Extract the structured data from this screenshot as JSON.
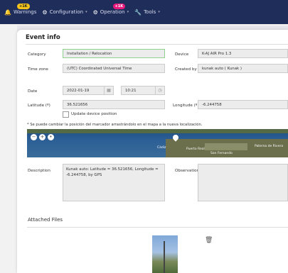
{
  "nav": {
    "warnings": {
      "label": "Warnings",
      "badge": "+1K"
    },
    "configuration": {
      "label": "Configuration"
    },
    "operation": {
      "label": "Operation",
      "badge": "+1K"
    },
    "tools": {
      "label": "Tools"
    }
  },
  "modal": {
    "title": "Event info",
    "category": {
      "label": "Category",
      "value": "Installation / Relocation"
    },
    "device": {
      "label": "Device",
      "value": "K-AJ AIR Pro 1.3"
    },
    "timezone": {
      "label": "Time zone",
      "value": "(UTC) Coordinated Universal Time"
    },
    "created_by": {
      "label": "Created by",
      "value": "kunak auto ( Kunak )"
    },
    "date": {
      "label": "Date",
      "date_value": "2022-01-19",
      "time_value": "10:21"
    },
    "latitude": {
      "label": "Latitude (º)",
      "value": "36.521656"
    },
    "longitude": {
      "label": "Longitude (º)",
      "value": "-6.244758"
    },
    "update_position": {
      "label": "Update device position"
    },
    "map_note": "* Se puede cambiar la posición del marcador arrastrándolo en el mapa a la nueva localización.",
    "map": {
      "labels": [
        "Cádiz",
        "Puerto Real",
        "San Fernando",
        "Paterna de Rivera"
      ]
    },
    "description": {
      "label": "Description",
      "value": "Kunak auto: Latitude = 36.521656, Longitude = -6.244758, by GPS"
    },
    "observation": {
      "label": "Observation",
      "value": ""
    },
    "attached_files": {
      "label": "Attached Files"
    }
  }
}
